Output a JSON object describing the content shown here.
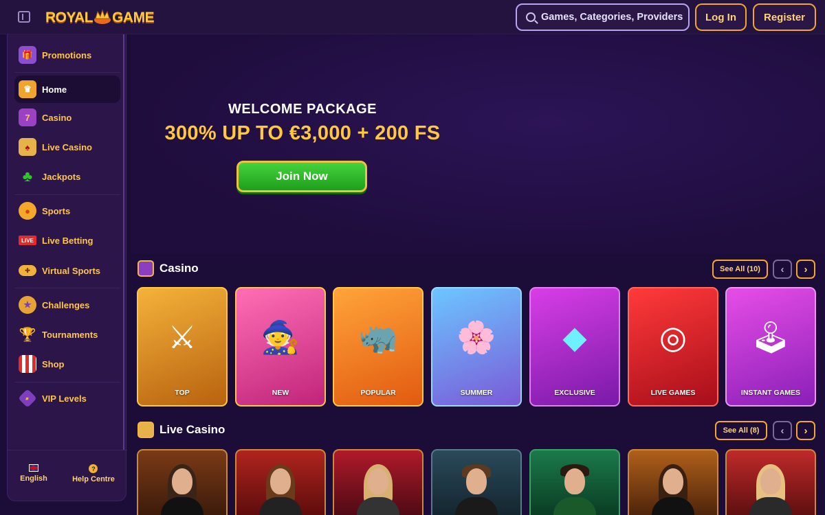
{
  "header": {
    "logo_left": "ROYAL",
    "logo_right": "GAME",
    "search_placeholder": "Games, Categories, Providers",
    "login_label": "Log In",
    "register_label": "Register"
  },
  "sidebar": {
    "items": [
      {
        "label": "Promotions",
        "icon": "promotions-icon"
      },
      {
        "label": "Home",
        "icon": "home-crown-icon",
        "active": true
      },
      {
        "label": "Casino",
        "icon": "slot-machine-icon"
      },
      {
        "label": "Live Casino",
        "icon": "cards-icon"
      },
      {
        "label": "Jackpots",
        "icon": "clover-icon"
      },
      {
        "label": "Sports",
        "icon": "sports-ball-icon"
      },
      {
        "label": "Live Betting",
        "icon": "live-badge-icon",
        "badge": "LIVE"
      },
      {
        "label": "Virtual Sports",
        "icon": "gamepad-icon"
      },
      {
        "label": "Challenges",
        "icon": "challenges-icon"
      },
      {
        "label": "Tournaments",
        "icon": "trophy-icon"
      },
      {
        "label": "Shop",
        "icon": "shop-icon"
      },
      {
        "label": "VIP Levels",
        "icon": "vip-icon"
      }
    ],
    "footer": {
      "language_label": "English",
      "help_label": "Help Centre"
    }
  },
  "hero": {
    "title": "WELCOME PACKAGE",
    "offer": "300% UP TO €3,000 + 200 FS",
    "cta": "Join Now"
  },
  "casino": {
    "title": "Casino",
    "see_all": "See All",
    "count": "(10)",
    "cards": [
      {
        "label": "TOP",
        "icon": "explorer-dwarf-art"
      },
      {
        "label": "NEW",
        "icon": "witch-art"
      },
      {
        "label": "POPULAR",
        "icon": "rhino-art"
      },
      {
        "label": "SUMMER",
        "icon": "summer-girl-art"
      },
      {
        "label": "EXCLUSIVE",
        "icon": "diamond-art"
      },
      {
        "label": "LIVE GAMES",
        "icon": "roulette-art"
      },
      {
        "label": "INSTANT GAMES",
        "icon": "joystick-art"
      }
    ]
  },
  "live_casino": {
    "title": "Live Casino",
    "see_all": "See All",
    "count": "(8)"
  },
  "colors": {
    "background": "#1c0d38",
    "accent_gold": "#ffc93a",
    "cta_green": "#2fb82b",
    "border_orange": "#f3a72b"
  }
}
